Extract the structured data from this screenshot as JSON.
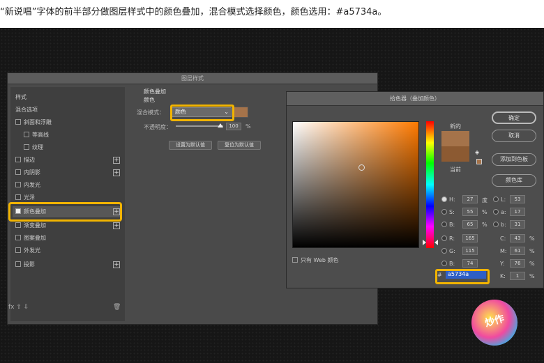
{
  "caption": "“新说唱”字体的前半部分做图层样式中的颜色叠加，混合模式选择颜色，颜色选用：#a5734a。",
  "layer_style": {
    "title": "图层样式",
    "items": [
      {
        "label": "样式",
        "checkbox": false,
        "plus": false,
        "sub": false
      },
      {
        "label": "混合选项",
        "checkbox": false,
        "plus": false,
        "sub": false
      },
      {
        "label": "斜面和浮雕",
        "checkbox": true,
        "checked": false,
        "plus": false,
        "sub": false
      },
      {
        "label": "等高线",
        "checkbox": true,
        "checked": false,
        "plus": false,
        "sub": true
      },
      {
        "label": "纹理",
        "checkbox": true,
        "checked": false,
        "plus": false,
        "sub": true
      },
      {
        "label": "描边",
        "checkbox": true,
        "checked": false,
        "plus": true,
        "sub": false
      },
      {
        "label": "内阴影",
        "checkbox": true,
        "checked": false,
        "plus": true,
        "sub": false
      },
      {
        "label": "内发光",
        "checkbox": true,
        "checked": false,
        "plus": false,
        "sub": false
      },
      {
        "label": "光泽",
        "checkbox": true,
        "checked": false,
        "plus": false,
        "sub": false
      },
      {
        "label": "颜色叠加",
        "checkbox": true,
        "checked": true,
        "plus": true,
        "sub": false
      },
      {
        "label": "渐变叠加",
        "checkbox": true,
        "checked": false,
        "plus": true,
        "sub": false
      },
      {
        "label": "图案叠加",
        "checkbox": true,
        "checked": false,
        "plus": false,
        "sub": false
      },
      {
        "label": "外发光",
        "checkbox": true,
        "checked": false,
        "plus": false,
        "sub": false
      },
      {
        "label": "投影",
        "checkbox": true,
        "checked": false,
        "plus": true,
        "sub": false
      }
    ],
    "bottom_icons": "fx ⇧ ⇩",
    "trash_icon": "trash-icon",
    "section_title": "颜色叠加",
    "section_sub": "颜色",
    "blend_label": "混合模式：",
    "blend_value": "颜色",
    "opacity_label": "不透明度：",
    "opacity_value": "100",
    "opacity_unit": "%",
    "btn_default": "设置为默认值",
    "btn_reset": "复位为默认值"
  },
  "color_picker": {
    "title": "拾色器（叠加颜色）",
    "new_label": "新的",
    "current_label": "当前",
    "ok": "确定",
    "cancel": "取消",
    "add_swatch": "添加到色板",
    "color_lib": "颜色库",
    "web_only": "只有 Web 颜色",
    "hsb": [
      {
        "k": "H:",
        "v": "27",
        "u": "度"
      },
      {
        "k": "S:",
        "v": "55",
        "u": "%"
      },
      {
        "k": "B:",
        "v": "65",
        "u": "%"
      }
    ],
    "rgb": [
      {
        "k": "R:",
        "v": "165"
      },
      {
        "k": "G:",
        "v": "115"
      },
      {
        "k": "B:",
        "v": "74"
      }
    ],
    "lab": [
      {
        "k": "L:",
        "v": "53"
      },
      {
        "k": "a:",
        "v": "17"
      },
      {
        "k": "b:",
        "v": "31"
      }
    ],
    "cmyk": [
      {
        "k": "C:",
        "v": "43",
        "u": "%"
      },
      {
        "k": "M:",
        "v": "61",
        "u": "%"
      },
      {
        "k": "Y:",
        "v": "76",
        "u": "%"
      },
      {
        "k": "K:",
        "v": "1",
        "u": "%"
      }
    ],
    "hex_prefix": "#",
    "hex_value": "a5734a",
    "new_color": "#a5734a",
    "current_color": "#8c5a32"
  },
  "logo_text": "炒作"
}
